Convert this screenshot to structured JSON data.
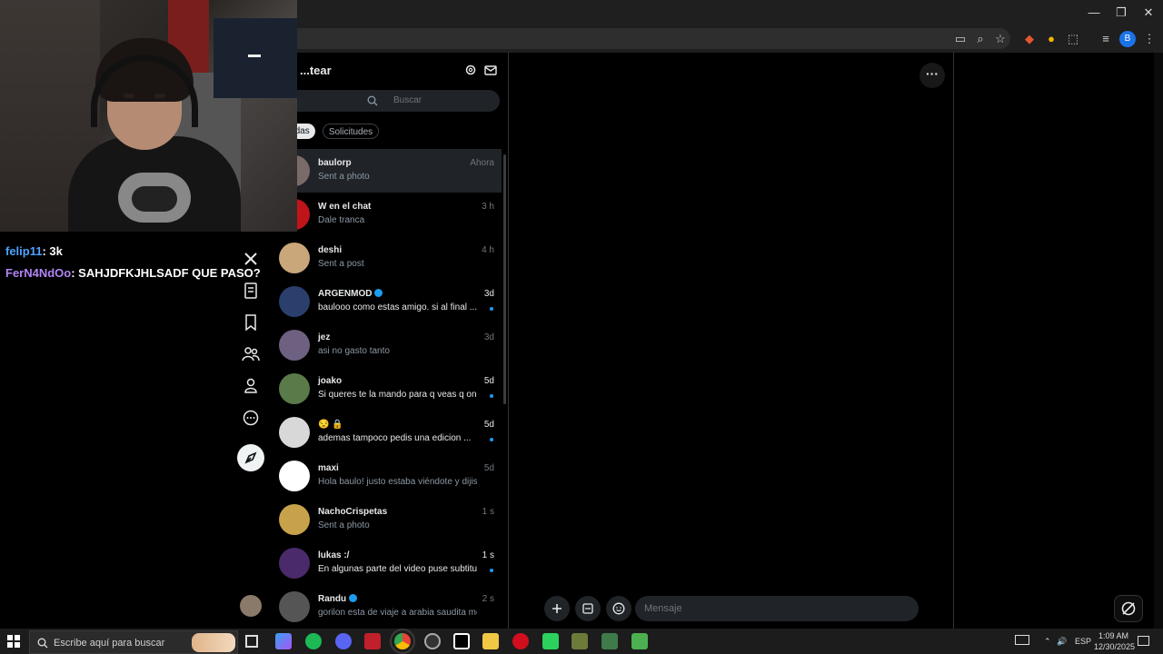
{
  "browser": {
    "window_controls": {
      "minimize": "—",
      "restore": "❐",
      "close": "✕"
    },
    "profile_initial": "B"
  },
  "overlay": {
    "chat": [
      {
        "user": "felip11",
        "text": ": 3k",
        "color": "#4da3ff"
      },
      {
        "user": "FerN4NdOo",
        "text": ": SAHJDFKJHLSADF QUE PASO?",
        "color": "#b084f5"
      }
    ]
  },
  "sidebar": {
    "icons": [
      "x-logo-icon",
      "lists-icon",
      "bookmark-icon",
      "communities-icon",
      "profile-icon",
      "more-icon",
      "compose-icon"
    ]
  },
  "messages": {
    "title": "...tear",
    "search_placeholder": "Buscar",
    "filters": {
      "all": "...das",
      "requests": "Solicitudes"
    },
    "conversations": [
      {
        "name": "baulorp",
        "preview": "Sent a photo",
        "time": "Ahora",
        "unread": false,
        "verified": false,
        "avatar_color": "#7a6a6a"
      },
      {
        "name": "W en el chat",
        "preview": "Dale tranca",
        "time": "3 h",
        "unread": false,
        "verified": false,
        "avatar_color": "#c0141b"
      },
      {
        "name": "deshi",
        "preview": "Sent a post",
        "time": "4 h",
        "unread": false,
        "verified": false,
        "avatar_color": "#c9a77a"
      },
      {
        "name": "ARGENMOD",
        "preview": "baulooo como estas amigo. si al final ...",
        "time": "3d",
        "unread": true,
        "verified": true,
        "avatar_color": "#2a3f6b"
      },
      {
        "name": "jez",
        "preview": "asi no gasto tanto",
        "time": "3d",
        "unread": false,
        "verified": false,
        "avatar_color": "#6e6080"
      },
      {
        "name": "joako",
        "preview": "Si queres te la mando para q veas q onda...",
        "time": "5d",
        "unread": true,
        "verified": false,
        "avatar_color": "#5a7a4a"
      },
      {
        "name": "😒 🔒",
        "preview": "ademas tampoco pedis una edicion ...",
        "time": "5d",
        "unread": true,
        "verified": false,
        "avatar_color": "#d8d8d8"
      },
      {
        "name": "maxi",
        "preview": "Hola baulo! justo estaba viéndote y dijiste qu...",
        "time": "5d",
        "unread": false,
        "verified": false,
        "avatar_color": "#ffffff"
      },
      {
        "name": "NachoCrispetas",
        "preview": "Sent a photo",
        "time": "1 s",
        "unread": false,
        "verified": false,
        "avatar_color": "#c7a24a"
      },
      {
        "name": "lukas :/",
        "preview": "En algunas parte del video puse subtitul...",
        "time": "1 s",
        "unread": true,
        "verified": false,
        "avatar_color": "#4a2a6a"
      },
      {
        "name": "Randu",
        "preview": "gorilon esta de viaje a arabia saudita me acab...",
        "time": "2 s",
        "unread": false,
        "verified": true,
        "avatar_color": "#555555"
      }
    ]
  },
  "conversation": {
    "message_placeholder": "Mensaje"
  },
  "taskbar": {
    "search_placeholder": "Escribe aquí para buscar",
    "language": "ESP",
    "time": "1:09 AM",
    "date": "12/30/2025"
  }
}
